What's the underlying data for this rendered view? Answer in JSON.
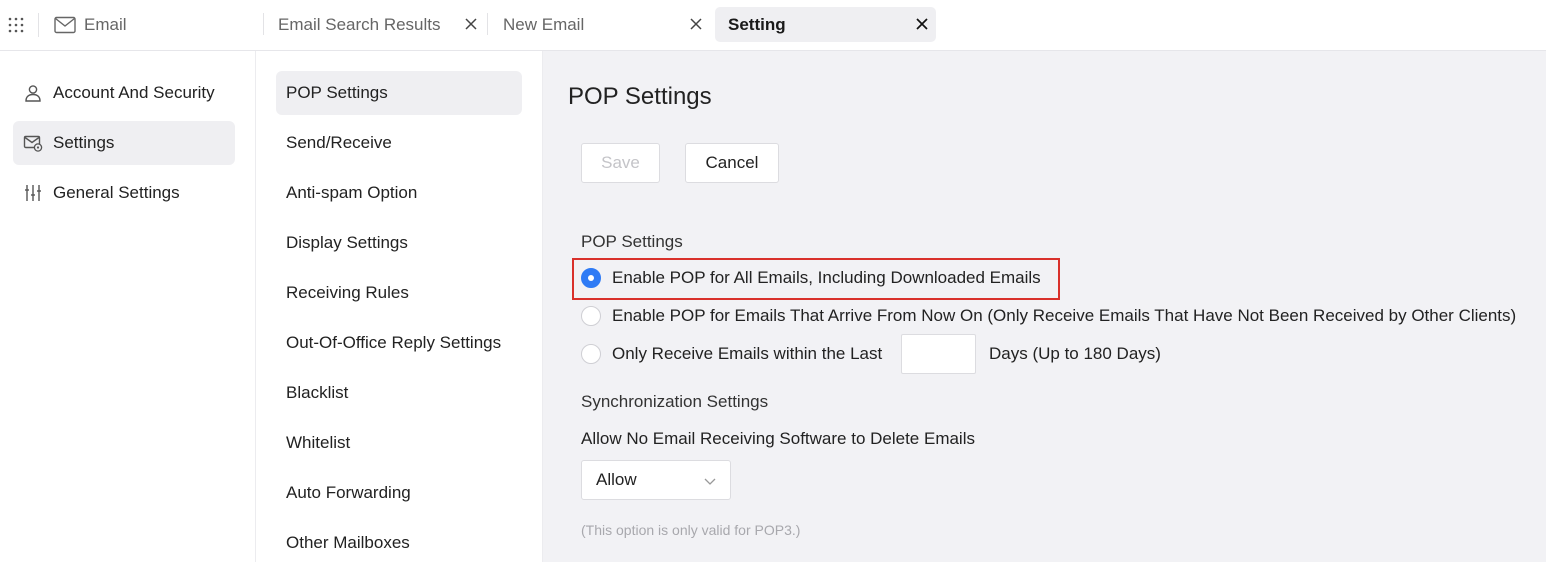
{
  "topbar": {
    "app_name": "Email",
    "tabs": [
      {
        "label": "Email Search Results"
      },
      {
        "label": "New Email"
      },
      {
        "label": "Setting"
      }
    ],
    "icons": {
      "apps": "grid-dots-icon",
      "mail": "envelope-icon",
      "close": "close-icon"
    }
  },
  "sidebar": {
    "items": [
      {
        "label": "Account And Security",
        "icon": "user-icon"
      },
      {
        "label": "Settings",
        "icon": "mail-gear-icon"
      },
      {
        "label": "General Settings",
        "icon": "sliders-icon"
      }
    ]
  },
  "menu": {
    "items": [
      {
        "label": "POP Settings"
      },
      {
        "label": "Send/Receive"
      },
      {
        "label": "Anti-spam Option"
      },
      {
        "label": "Display Settings"
      },
      {
        "label": "Receiving Rules"
      },
      {
        "label": "Out-Of-Office Reply Settings"
      },
      {
        "label": "Blacklist"
      },
      {
        "label": "Whitelist"
      },
      {
        "label": "Auto Forwarding"
      },
      {
        "label": "Other Mailboxes"
      }
    ]
  },
  "main": {
    "title": "POP Settings",
    "save_label": "Save",
    "cancel_label": "Cancel",
    "pop_section_label": "POP Settings",
    "options": [
      {
        "label": "Enable POP for All Emails, Including Downloaded Emails",
        "checked": true
      },
      {
        "label": "Enable POP for Emails That Arrive From Now On (Only Receive Emails That Have Not Been Received by Other Clients)",
        "checked": false
      },
      {
        "label": "Only Receive Emails within the Last",
        "checked": false
      }
    ],
    "days_value": "",
    "days_suffix": "Days (Up to 180 Days)",
    "sync_section_label": "Synchronization Settings",
    "delete_label": "Allow No Email Receiving Software to Delete Emails",
    "delete_select_value": "Allow",
    "note": "(This option is only valid for POP3.)"
  },
  "colors": {
    "accent": "#2f7bf5",
    "highlight_border": "#d9312b",
    "content_bg": "#f2f2f5",
    "active_bg": "#efeff2"
  }
}
